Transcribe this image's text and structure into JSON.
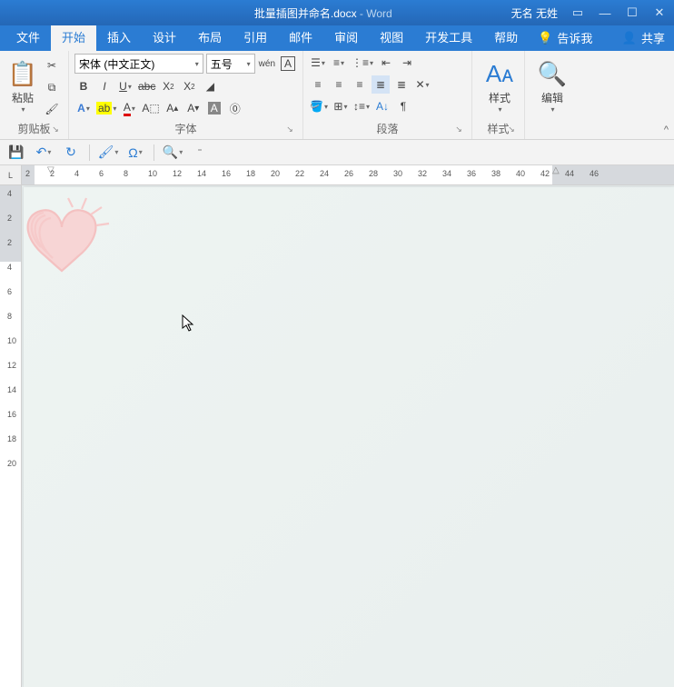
{
  "title": {
    "filename": "批量插图并命名.docx",
    "sep": " - ",
    "app": "Word"
  },
  "user": {
    "name": "无名 无姓"
  },
  "tabs": {
    "items": [
      "文件",
      "开始",
      "插入",
      "设计",
      "布局",
      "引用",
      "邮件",
      "审阅",
      "视图",
      "开发工具",
      "帮助"
    ],
    "active": 1,
    "tellme": "告诉我",
    "share": "共享"
  },
  "ribbon": {
    "clipboard": {
      "label": "剪贴板",
      "paste": "粘贴"
    },
    "font": {
      "label": "字体",
      "name": "宋体 (中文正文)",
      "size": "五号"
    },
    "paragraph": {
      "label": "段落"
    },
    "styles": {
      "label": "样式",
      "btn": "样式"
    },
    "editing": {
      "label": "编辑",
      "btn": "编辑"
    }
  },
  "hruler": {
    "marks": [
      "2",
      "2",
      "4",
      "6",
      "8",
      "10",
      "12",
      "14",
      "16",
      "18",
      "20",
      "22",
      "24",
      "26",
      "28",
      "30",
      "32",
      "34",
      "36",
      "38",
      "40",
      "42",
      "44",
      "46"
    ]
  },
  "vruler": {
    "marks": [
      "4",
      "2",
      "2",
      "4",
      "6",
      "8",
      "10",
      "12",
      "14",
      "16",
      "18",
      "20"
    ]
  }
}
